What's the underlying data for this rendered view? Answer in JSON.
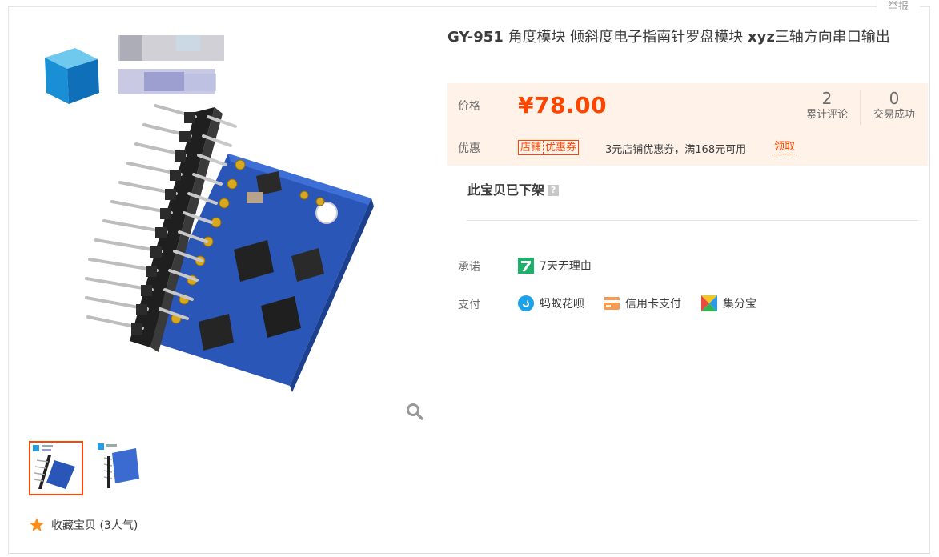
{
  "report_label": "举报",
  "title": {
    "model": "GY-951",
    "text": " 角度模块 倾斜度电子指南针罗盘模块 ",
    "xyz": "xyz",
    "text2": "三轴方向串口输出"
  },
  "price": {
    "label": "价格",
    "value": "¥78.00",
    "reviews_count": "2",
    "reviews_label": "累计评论",
    "deals_count": "0",
    "deals_label": "交易成功"
  },
  "promo": {
    "label": "优惠",
    "tag_left": "店铺",
    "tag_right": "优惠券",
    "text": "3元店铺优惠券，满168元可用",
    "get_label": "领取"
  },
  "status": {
    "offline_text": "此宝贝已下架",
    "help_icon": "question-icon"
  },
  "promise": {
    "label": "承诺",
    "icon": "seven-day-icon",
    "text": "7天无理由"
  },
  "payment": {
    "label": "支付",
    "methods": [
      {
        "icon": "huabei-icon",
        "label": "蚂蚁花呗"
      },
      {
        "icon": "credit-card-icon",
        "label": "信用卡支付"
      },
      {
        "icon": "jifenbao-icon",
        "label": "集分宝"
      }
    ]
  },
  "favorite": {
    "text": "收藏宝贝 (3人气)"
  },
  "colors": {
    "accent": "#ff4400",
    "price_bg": "#fff2e8",
    "pcb_blue": "#2a56b8"
  }
}
